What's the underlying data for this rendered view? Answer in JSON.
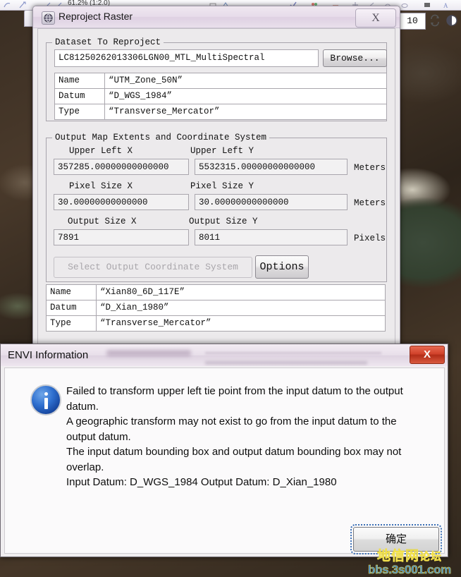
{
  "background": {
    "zoom_text": "61.2%  (1:2.0)",
    "spinner_value": "10",
    "icons": [
      "refresh-icon",
      "layer-circle-icon",
      "roi-icon",
      "polygon-icon",
      "line-icon",
      "text-icon"
    ]
  },
  "reproject_dialog": {
    "title": "Reproject Raster",
    "app_icon": "envi-globe-icon",
    "close_label": "X",
    "dataset_group": {
      "legend": "Dataset To Reproject",
      "input_value": "LC81250262013306LGN00_MTL_MultiSpectral",
      "browse_label": "Browse...",
      "rows": [
        {
          "key": "Name",
          "value": "“UTM_Zone_50N”"
        },
        {
          "key": "Datum",
          "value": "“D_WGS_1984”"
        },
        {
          "key": "Type",
          "value": "“Transverse_Mercator”"
        }
      ]
    },
    "extents_group": {
      "legend": "Output Map Extents and Coordinate System",
      "upper_left_x_label": "Upper Left X",
      "upper_left_x_value": "357285.00000000000000",
      "upper_left_y_label": "Upper Left Y",
      "upper_left_y_value": "5532315.00000000000000",
      "upper_left_units": "Meters",
      "pixel_size_x_label": "Pixel Size X",
      "pixel_size_x_value": "30.00000000000000",
      "pixel_size_y_label": "Pixel Size Y",
      "pixel_size_y_value": "30.00000000000000",
      "pixel_size_units": "Meters",
      "output_size_x_label": "Output Size X",
      "output_size_x_value": "7891",
      "output_size_y_label": "Output Size Y",
      "output_size_y_value": "8011",
      "output_size_units": "Pixels"
    },
    "coord_select_label": "Select Output Coordinate System",
    "options_label": "Options",
    "output_rows": [
      {
        "key": "Name",
        "value": "“Xian80_6D_117E”"
      },
      {
        "key": "Datum",
        "value": "“D_Xian_1980”"
      },
      {
        "key": "Type",
        "value": "“Transverse_Mercator”"
      }
    ]
  },
  "envi_info_dialog": {
    "title": "ENVI Information",
    "close_label": "X",
    "icon": "info-icon",
    "message_lines": [
      "Failed to transform upper left tie point from the input datum to the output datum.",
      "A geographic transform may not exist to go from the input datum to the output datum.",
      "The input datum bounding box and output datum bounding box may not overlap.",
      "Input Datum: D_WGS_1984 Output Datum: D_Xian_1980"
    ],
    "ok_label": "确定"
  },
  "watermark": {
    "chinese": "地信网",
    "chinese_red": "论坛",
    "url": "bbs.3s001.com"
  },
  "colors": {
    "accent": "#2a66c4",
    "error_close": "#d0412a",
    "info_blue": "#2f6fcf"
  }
}
